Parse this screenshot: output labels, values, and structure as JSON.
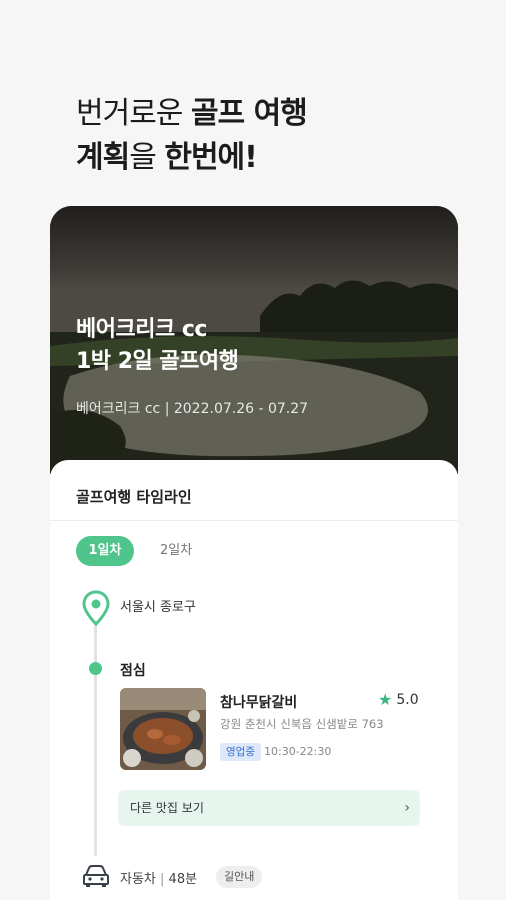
{
  "headline": {
    "line1_light": "번거로운 ",
    "line1_bold": "골프 여행",
    "line2_bold": "계획",
    "line2_light": "을 ",
    "line2_bold2": "한번에!"
  },
  "hero": {
    "title_line1": "베어크리크 cc",
    "title_line2": "1박 2일 골프여행",
    "subtitle": "베어크리크 cc | 2022.07.26 - 07.27"
  },
  "timeline": {
    "title": "골프여행 타임라인",
    "tabs": [
      {
        "label": "1일차",
        "active": true
      },
      {
        "label": "2일차",
        "active": false
      }
    ],
    "start_location": "서울시 종로구",
    "meal_label": "점심",
    "restaurant": {
      "name": "참나무닭갈비",
      "rating": "5.0",
      "address": "강원 춘천시 신북읍 신샘밭로 763",
      "status": "영업중",
      "hours": "10:30-22:30"
    },
    "more_button": "다른 맛집 보기",
    "transport": {
      "mode": "자동차",
      "separator": " | ",
      "duration": "48분",
      "directions_label": "길안내"
    }
  },
  "colors": {
    "accent": "#4fc58b",
    "badge_bg": "#dde9fb",
    "badge_text": "#3a6fd0"
  }
}
